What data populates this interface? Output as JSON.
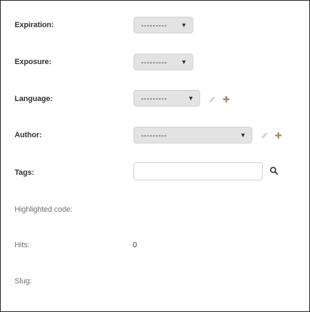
{
  "fields": {
    "expiration": {
      "label": "Expiration:",
      "value": "---------",
      "arrow": "▼"
    },
    "exposure": {
      "label": "Exposure:",
      "value": "---------",
      "arrow": "▼"
    },
    "language": {
      "label": "Language:",
      "value": "---------",
      "arrow": "▼"
    },
    "author": {
      "label": "Author:",
      "value": "---------",
      "arrow": "▼"
    },
    "tags": {
      "label": "Tags:",
      "value": ""
    },
    "highlighted_code": {
      "label": "Highlighted code:"
    },
    "hits": {
      "label": "Hits:",
      "value": "0"
    },
    "slug": {
      "label": "Slug:"
    }
  },
  "icons": {
    "edit": "pencil-icon",
    "add": "plus-icon",
    "search": "search-icon"
  },
  "colors": {
    "select_bg": "#e3e3e3",
    "action_icon": "#9a8460",
    "disabled_icon": "#cfcfcf"
  }
}
